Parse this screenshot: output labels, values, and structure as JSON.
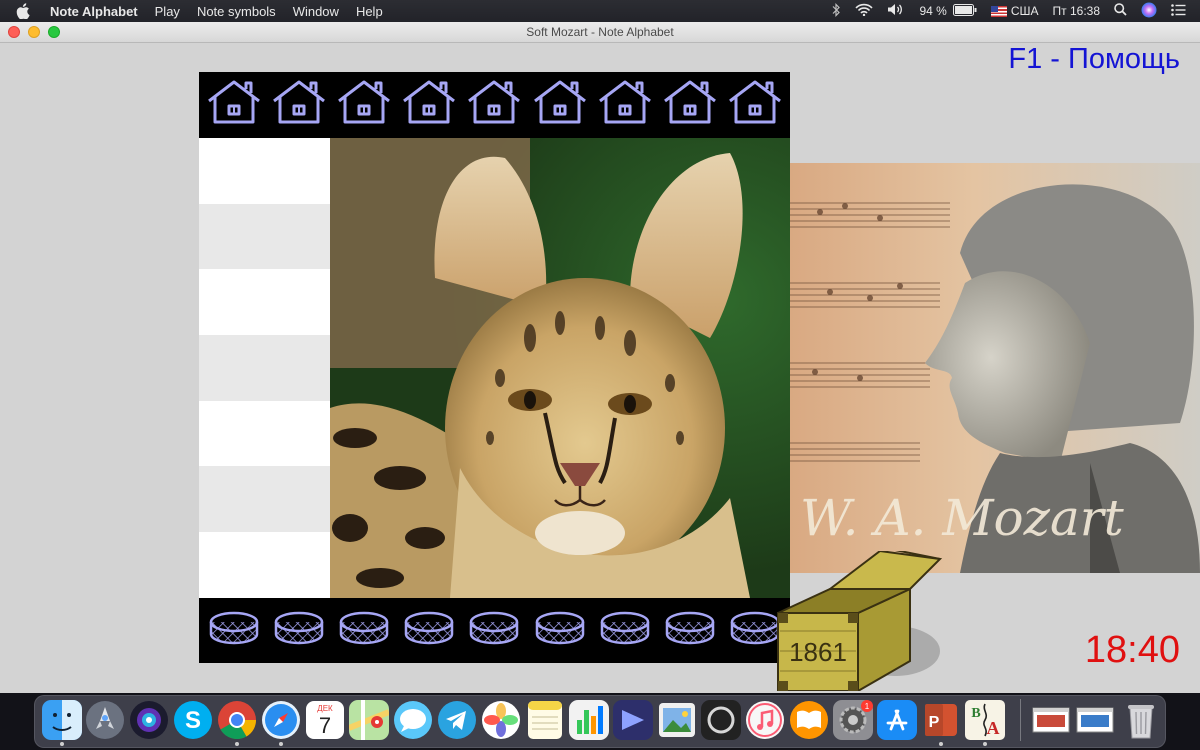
{
  "menubar": {
    "app_name": "Note Alphabet",
    "items": [
      "Play",
      "Note symbols",
      "Window",
      "Help"
    ],
    "battery": "94 %",
    "keyboard_layout": "США",
    "datetime": "Пт 16:38"
  },
  "window": {
    "title": "Soft Mozart - Note Alphabet"
  },
  "app": {
    "help_text": "F1 - Помощь",
    "timer": "18:40",
    "chest_number": "1861",
    "mozart_signature": "W. A. Mozart",
    "calendar_month": "ДЕК",
    "calendar_day": "7",
    "appstore_badge": "1",
    "colors": {
      "background": "#d3d3d3",
      "help_text": "#1414d4",
      "timer": "#e01010",
      "house_outline": "#a6a6f4",
      "board": "#000000"
    }
  }
}
